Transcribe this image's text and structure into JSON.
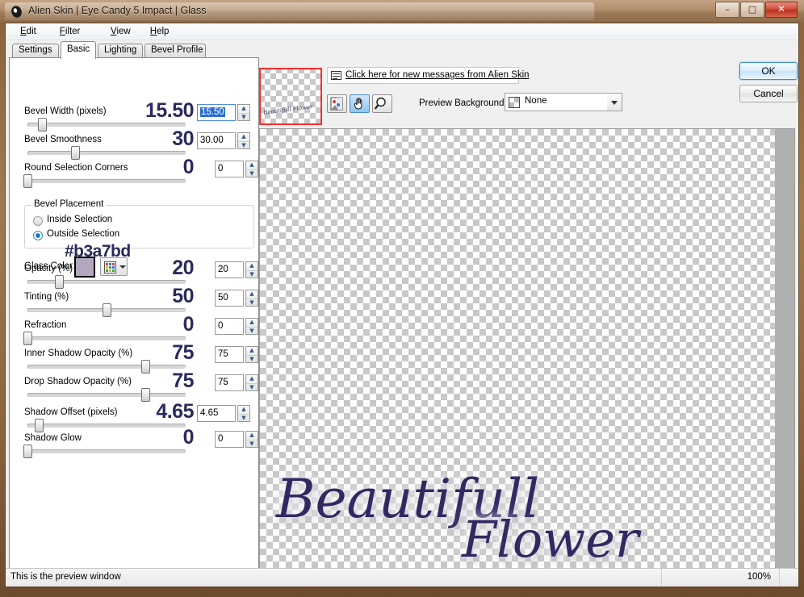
{
  "window": {
    "title": "Alien Skin | Eye Candy 5 Impact | Glass",
    "icon": "alien-head-icon",
    "buttons": {
      "minimize": "–",
      "maximize": "□",
      "close": "✕"
    }
  },
  "menubar": {
    "items": [
      {
        "label": "Edit",
        "accel": "E"
      },
      {
        "label": "Filter",
        "accel": "F"
      },
      {
        "label": "View",
        "accel": "V"
      },
      {
        "label": "Help",
        "accel": "H"
      }
    ]
  },
  "tabs": [
    {
      "label": "Settings",
      "active": false
    },
    {
      "label": "Basic",
      "active": true
    },
    {
      "label": "Lighting",
      "active": false
    },
    {
      "label": "Bevel Profile",
      "active": false
    }
  ],
  "sliders": [
    {
      "label": "Bevel Width (pixels)",
      "big": "15.50",
      "field": "15.50",
      "selected": true,
      "pct": 9
    },
    {
      "label": "Bevel Smoothness",
      "big": "30",
      "field": "30.00",
      "selected": false,
      "pct": 30
    },
    {
      "label": "Round Selection Corners",
      "big": "0",
      "field": "0",
      "selected": false,
      "pct": 0
    },
    {
      "label": "Opacity (%)",
      "big": "20",
      "field": "20",
      "selected": false,
      "pct": 20
    },
    {
      "label": "Tinting (%)",
      "big": "50",
      "field": "50",
      "selected": false,
      "pct": 50
    },
    {
      "label": "Refraction",
      "big": "0",
      "field": "0",
      "selected": false,
      "pct": 0
    },
    {
      "label": "Inner Shadow Opacity (%)",
      "big": "75",
      "field": "75",
      "selected": false,
      "pct": 75
    },
    {
      "label": "Drop Shadow Opacity (%)",
      "big": "75",
      "field": "75",
      "selected": false,
      "pct": 75
    },
    {
      "label": "Shadow Offset (pixels)",
      "big": "4.65",
      "field": "4.65",
      "selected": false,
      "pct": 7
    },
    {
      "label": "Shadow Glow",
      "big": "0",
      "field": "0",
      "selected": false,
      "pct": 0
    }
  ],
  "bevel_placement": {
    "legend": "Bevel Placement",
    "options": [
      {
        "label": "Inside Selection",
        "selected": false
      },
      {
        "label": "Outside Selection",
        "selected": true
      }
    ]
  },
  "glass_color": {
    "label": "Glass Color",
    "swatch_hex": "#b3a7bd",
    "palette_icon": "color-palette-icon"
  },
  "annotation": {
    "text": "#b3a7bd",
    "color": "#2b2a5e"
  },
  "message_bar": {
    "icon": "message-icon",
    "link_text": "Click here for new messages from Alien Skin"
  },
  "tools": [
    {
      "name": "compare-tool",
      "icon": "before-after-icon",
      "active": false
    },
    {
      "name": "pan-tool",
      "icon": "hand-icon",
      "active": true
    },
    {
      "name": "zoom-tool",
      "icon": "magnifier-icon",
      "active": false
    }
  ],
  "preview_background": {
    "label": "Preview Background:",
    "value": "None",
    "swatch": "checker-swatch"
  },
  "dialog_buttons": {
    "ok": "OK",
    "cancel": "Cancel"
  },
  "navigator": {
    "thumb_label": "Beautifull Flower",
    "selection_color": "#ff2d2d"
  },
  "artwork": {
    "line1": "Beautifull",
    "line2": "Flower",
    "ink_color": "#302a63"
  },
  "statusbar": {
    "message": "This is the preview window",
    "zoom": "100%"
  }
}
